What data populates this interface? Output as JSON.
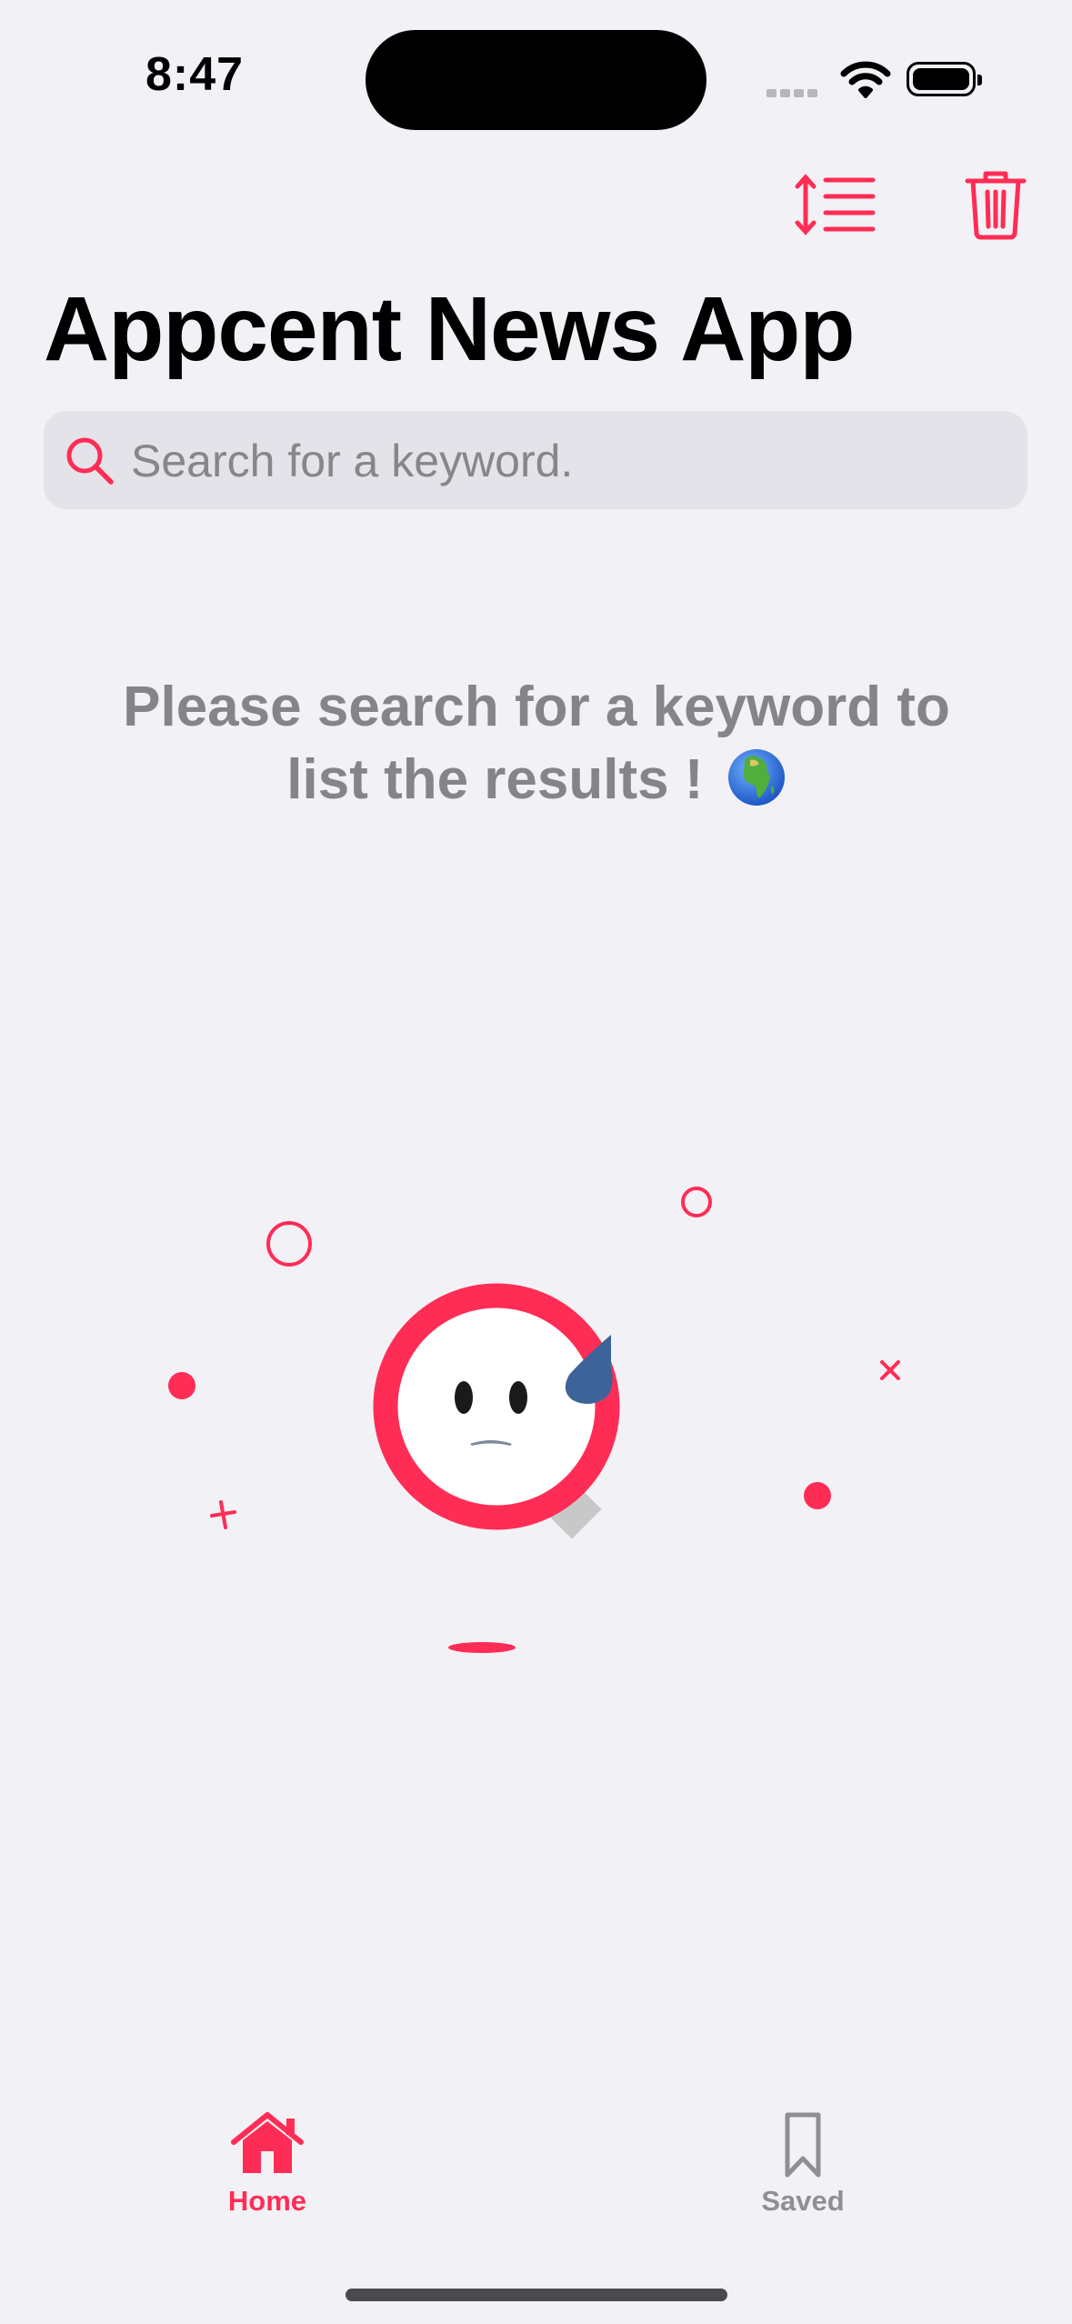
{
  "status_bar": {
    "time": "8:47"
  },
  "header": {
    "sort_icon": "sort-lines-icon",
    "trash_icon": "trash-icon",
    "title": "Appcent News App"
  },
  "search": {
    "placeholder": "Search for a keyword.",
    "value": ""
  },
  "empty_state": {
    "message": "Please search for a keyword to list the results !",
    "emoji": "globe-africa-emoji",
    "illustration": "sad-magnifier-illustration"
  },
  "tab_bar": {
    "items": [
      {
        "label": "Home",
        "icon": "house-icon",
        "selected": true
      },
      {
        "label": "Saved",
        "icon": "bookmark-icon",
        "selected": false
      }
    ]
  },
  "colors": {
    "accent": "#ff2d55",
    "background": "#f2f1f6",
    "search_bg": "#e4e3e9",
    "muted_text": "#848489",
    "inactive_tab": "#8e8e93",
    "drop": "#3d6498"
  }
}
